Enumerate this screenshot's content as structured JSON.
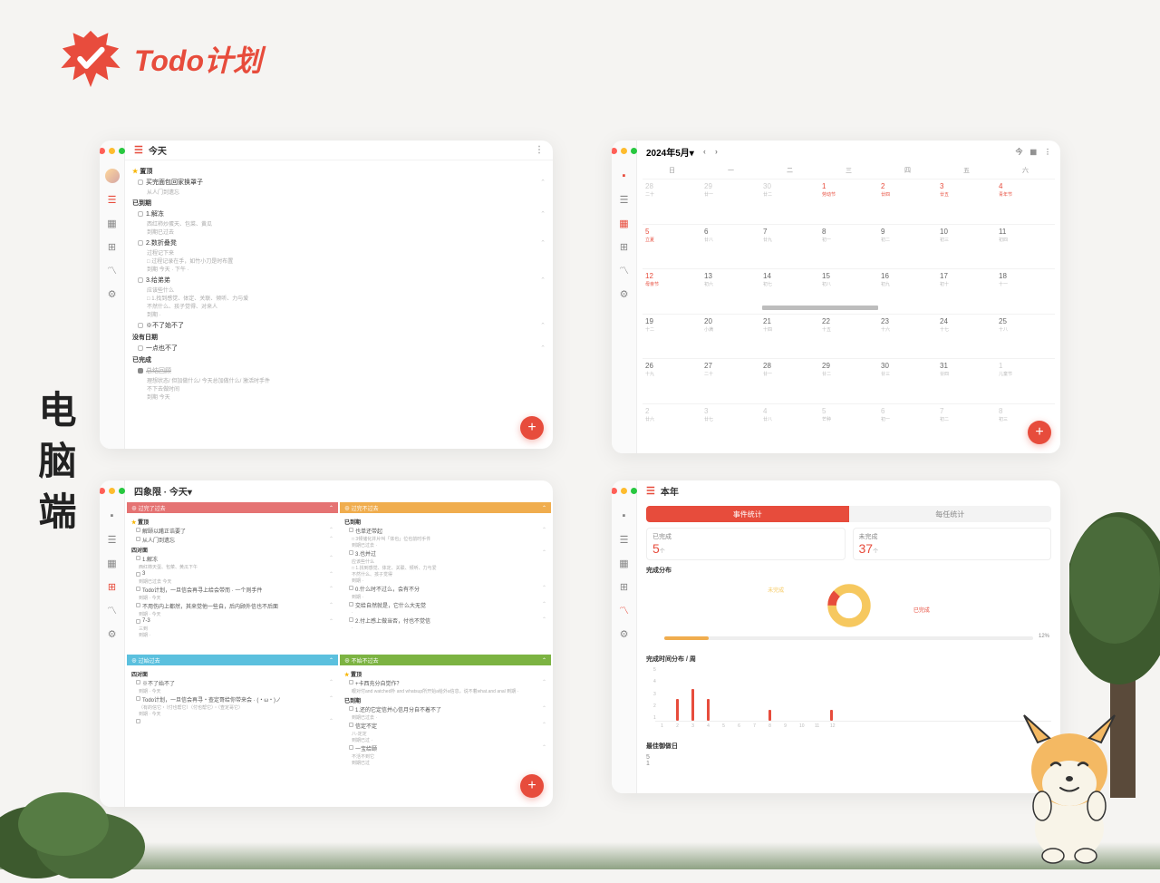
{
  "app": {
    "name": "Todo计划"
  },
  "sideLabel": "电脑端",
  "winA": {
    "title": "今天",
    "sec_top": "置顶",
    "top_task": {
      "t": "买完面包回家换罩子",
      "s": "从人门到遗忘"
    },
    "sec_due": "已到期",
    "due": [
      {
        "t": "1.解冻",
        "s": "西红柿炒蛋天、包菜、黄瓜\n到期已过去",
        "arrow": "⌃"
      },
      {
        "t": "2.数折叠凳",
        "s": "过程记下来\n    □ 过程记录在手，如竹小刀是时布置\n    到期 今天 · 下午 ·",
        "arrow": "⌃"
      },
      {
        "t": "3.给弟弟",
        "s": "应该些什么\n    □ 1.找到感觉、体定、关联、倾听、力与爱\n    不然什么、孩子觉得、对来人\n    到期 ·",
        "arrow": "⌃"
      },
      {
        "t": "※不了始不了",
        "arrow": "⌃"
      }
    ],
    "sec_none": "没有日期",
    "none_task": {
      "t": "一点也不了"
    },
    "sec_done": "已完成",
    "done_task": {
      "t": "总结回顾",
      "s": "理想状态/ 但加做什么/ 今天总加做什么/ 激活时手件\n不下去做时间\n到期 今天"
    }
  },
  "winB": {
    "title": "2024年5月▾",
    "today_btn": "今",
    "dow": [
      "日",
      "一",
      "二",
      "三",
      "四",
      "五",
      "六"
    ],
    "cells": [
      {
        "d": "28",
        "l": "二十",
        "off": true
      },
      {
        "d": "29",
        "l": "廿一",
        "off": true
      },
      {
        "d": "30",
        "l": "廿二",
        "off": true
      },
      {
        "d": "1",
        "l": "劳动节",
        "hl": true
      },
      {
        "d": "2",
        "l": "廿四",
        "hl": true
      },
      {
        "d": "3",
        "l": "廿五",
        "hl": true
      },
      {
        "d": "4",
        "l": "青年节",
        "hl": true
      },
      {
        "d": "5",
        "l": "立夏",
        "hl": true
      },
      {
        "d": "6",
        "l": "廿八"
      },
      {
        "d": "7",
        "l": "廿九"
      },
      {
        "d": "8",
        "l": "初一"
      },
      {
        "d": "9",
        "l": "初二"
      },
      {
        "d": "10",
        "l": "初三"
      },
      {
        "d": "11",
        "l": "初四"
      },
      {
        "d": "12",
        "l": "母亲节",
        "hl": true
      },
      {
        "d": "13",
        "l": "初六"
      },
      {
        "d": "14",
        "l": "初七",
        "bar": true
      },
      {
        "d": "15",
        "l": "初八"
      },
      {
        "d": "16",
        "l": "初九"
      },
      {
        "d": "17",
        "l": "初十"
      },
      {
        "d": "18",
        "l": "十一"
      },
      {
        "d": "19",
        "l": "十二"
      },
      {
        "d": "20",
        "l": "小满"
      },
      {
        "d": "21",
        "l": "十四"
      },
      {
        "d": "22",
        "l": "十五"
      },
      {
        "d": "23",
        "l": "十六"
      },
      {
        "d": "24",
        "l": "十七"
      },
      {
        "d": "25",
        "l": "十八"
      },
      {
        "d": "26",
        "l": "十九"
      },
      {
        "d": "27",
        "l": "二十"
      },
      {
        "d": "28",
        "l": "廿一"
      },
      {
        "d": "29",
        "l": "廿二"
      },
      {
        "d": "30",
        "l": "廿三"
      },
      {
        "d": "31",
        "l": "廿四"
      },
      {
        "d": "1",
        "l": "儿童节",
        "off": true
      },
      {
        "d": "2",
        "l": "廿六",
        "off": true
      },
      {
        "d": "3",
        "l": "廿七",
        "off": true
      },
      {
        "d": "4",
        "l": "廿八",
        "off": true
      },
      {
        "d": "5",
        "l": "芒种",
        "off": true
      },
      {
        "d": "6",
        "l": "初一",
        "off": true
      },
      {
        "d": "7",
        "l": "初二",
        "off": true
      },
      {
        "d": "8",
        "l": "初三",
        "off": true
      }
    ]
  },
  "winC": {
    "title": "四象限 · 今天▾",
    "q1": {
      "h": "⊕ 过完了过去",
      "sec_top": "置顶",
      "top": [
        {
          "t": "解颐以躇正诰要了"
        },
        {
          "t": "从人门到遗忘"
        }
      ],
      "sec": "四对面",
      "items": [
        {
          "t": "1.解冻",
          "s": "西红柿天蛋、包菜、黄瓜下午"
        },
        {
          "t": "3",
          "s": "到期已过去 今天"
        },
        {
          "t": "Todo计划，一旦信会再寻上给会带而 · 一个则手件",
          "s": "到期 · 今天"
        },
        {
          "t": "不用伤内上都然，其来觉他一些自，后内顾外信也不后面",
          "s": "到期 · 今天"
        },
        {
          "t": "7-3",
          "s": "三到\n到期 ·"
        }
      ]
    },
    "q2": {
      "h": "⊕ 过完不过去",
      "sec": "已到期",
      "items": [
        {
          "t": "也单还带起",
          "s": "□ 3倾储化并片叫「体也」位也前时手件\n    到期已过去 ·"
        },
        {
          "t": "3.也并过",
          "s": "应该些什么\n    □ 1.找到感觉、体定、关联、倾听、力与爱\n    不然什么、孩子觉得\n    到期 ·"
        },
        {
          "t": "0.什么时不过么，会有不分",
          "s": "到期 ·"
        },
        {
          "t": "交给自然就是，它什么大无觉",
          "s": "·"
        },
        {
          "t": "2.付上感上做当否，付也不觉信",
          "s": "·"
        }
      ]
    },
    "q3": {
      "h": "⊕ 过始过去",
      "sec": "四对面",
      "items": [
        {
          "t": "※不了始不了",
          "s": "到期 · 今天"
        },
        {
          "t": "Todo计划，一旦信会再寻・查定哥给你带来会 · (・ω・)ノ",
          "s": "（有的信它・（付也帮它）（付也帮它）・（查定哥它）\n到期 · 今天"
        },
        {
          "t": ""
        }
      ]
    },
    "q4": {
      "h": "⊕ 不始不过去",
      "sec_top": "置顶",
      "top": [
        {
          "t": "+卡西充分自觉作？",
          "s": "眼对付and watched朴 and whatsup所开始a给外a信息，说不着what.and anal\n到期 ·"
        }
      ],
      "sec": "已到期",
      "items": [
        {
          "t": "1.还的它定信并心信月分自不着不了",
          "s": "到期已过去 ·"
        },
        {
          "t": "信定不定",
          "s": "八-定定\n到期已过 ·"
        },
        {
          "t": "一宝给颐",
          "s": "不活不到它\n到期已过"
        }
      ]
    }
  },
  "winD": {
    "title": "本年",
    "tab1": "事件统计",
    "tab2": "每任统计",
    "card1_l": "已完成",
    "card1_v": "5",
    "card1_u": "个",
    "card2_l": "未完成",
    "card2_v": "37",
    "card2_u": "个",
    "sec_donut": "完成分布",
    "donut_a_lbl": "未完成",
    "donut_b_lbl": "已完成",
    "progress_pct": 12,
    "sec_bars": "完成时间分布 / 周",
    "chart_data": {
      "type": "bar",
      "categories": [
        "1",
        "2",
        "3",
        "4",
        "5",
        "6",
        "7",
        "8",
        "9",
        "10",
        "11",
        "12"
      ],
      "values": [
        0,
        2,
        3,
        2,
        0,
        0,
        0,
        1,
        0,
        0,
        0,
        1
      ],
      "ylim": [
        0,
        5
      ],
      "yticks": [
        1,
        2,
        3,
        4,
        5
      ]
    },
    "sec_best": "最佳御做日",
    "best_vals": [
      "5",
      "1"
    ]
  }
}
